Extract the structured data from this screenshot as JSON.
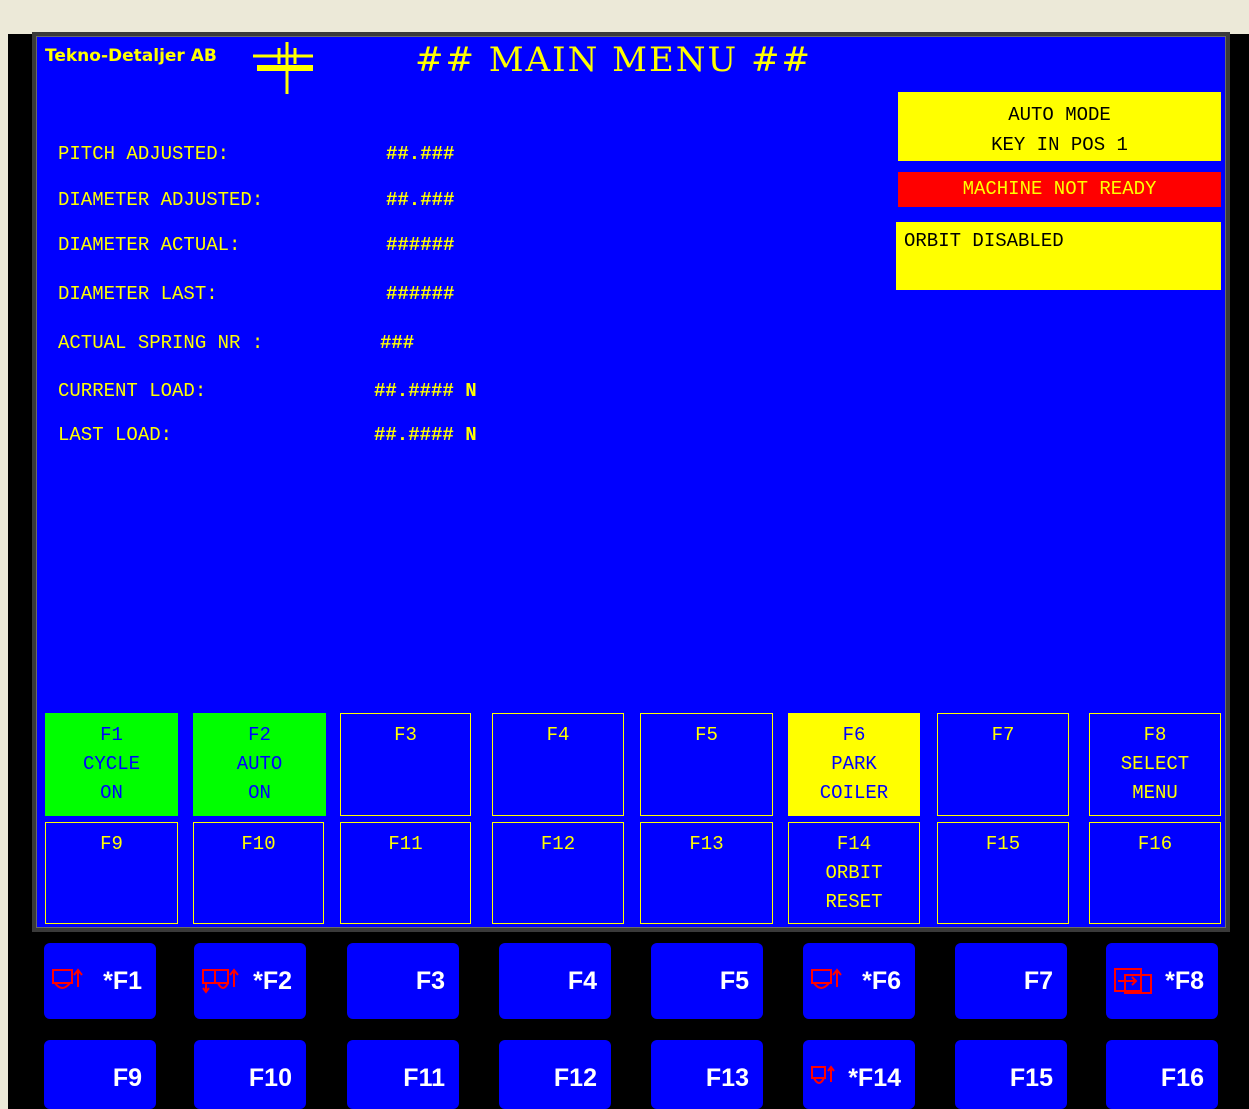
{
  "brand": "Tekno-Detaljer AB",
  "title": "## MAIN MENU ##",
  "fields": [
    {
      "label": "PITCH ADJUSTED:",
      "value": "##.###"
    },
    {
      "label": "DIAMETER ADJUSTED:",
      "value": "##.###"
    },
    {
      "label": "DIAMETER ACTUAL:",
      "value": "######"
    },
    {
      "label": "DIAMETER LAST:",
      "value": "######"
    },
    {
      "label": "ACTUAL SPRING NR :",
      "value": "###"
    },
    {
      "label": "CURRENT LOAD:",
      "value": "##.#### N"
    },
    {
      "label": "LAST LOAD:",
      "value": "##.#### N"
    }
  ],
  "status": {
    "mode_line1": "AUTO MODE",
    "mode_line2": "KEY IN POS 1",
    "ready": "MACHINE NOT READY",
    "orbit": "ORBIT DISABLED"
  },
  "screen_keys": [
    [
      "F1",
      "CYCLE",
      "ON"
    ],
    [
      "F2",
      "AUTO",
      "ON"
    ],
    [
      "F3",
      "",
      ""
    ],
    [
      "F4",
      "",
      ""
    ],
    [
      "F5",
      "",
      ""
    ],
    [
      "F6",
      "PARK",
      "COILER"
    ],
    [
      "F7",
      "",
      ""
    ],
    [
      "F8",
      "SELECT",
      "MENU"
    ],
    [
      "F9",
      "",
      ""
    ],
    [
      "F10",
      "",
      ""
    ],
    [
      "F11",
      "",
      ""
    ],
    [
      "F12",
      "",
      ""
    ],
    [
      "F13",
      "",
      ""
    ],
    [
      "F14",
      "ORBIT",
      "RESET"
    ],
    [
      "F15",
      "",
      ""
    ],
    [
      "F16",
      "",
      ""
    ]
  ],
  "hard_keys": [
    "*F1",
    "*F2",
    "F3",
    "F4",
    "F5",
    "*F6",
    "F7",
    "*F8",
    "F9",
    "F10",
    "F11",
    "F12",
    "F13",
    "*F14",
    "F15",
    "F16"
  ],
  "colors": {
    "screen_bg": "#0000ff",
    "text": "#ffff00",
    "active_key": "#00ff00",
    "highlight_key": "#ffff00",
    "alarm": "#ff0000"
  },
  "icons": {
    "hard_key_icons": [
      "cycle-arrow-icon",
      "double-cycle-arrow-icon",
      "cycle-arrow-icon",
      "select-menu-icon",
      "cycle-arrow-icon"
    ]
  }
}
